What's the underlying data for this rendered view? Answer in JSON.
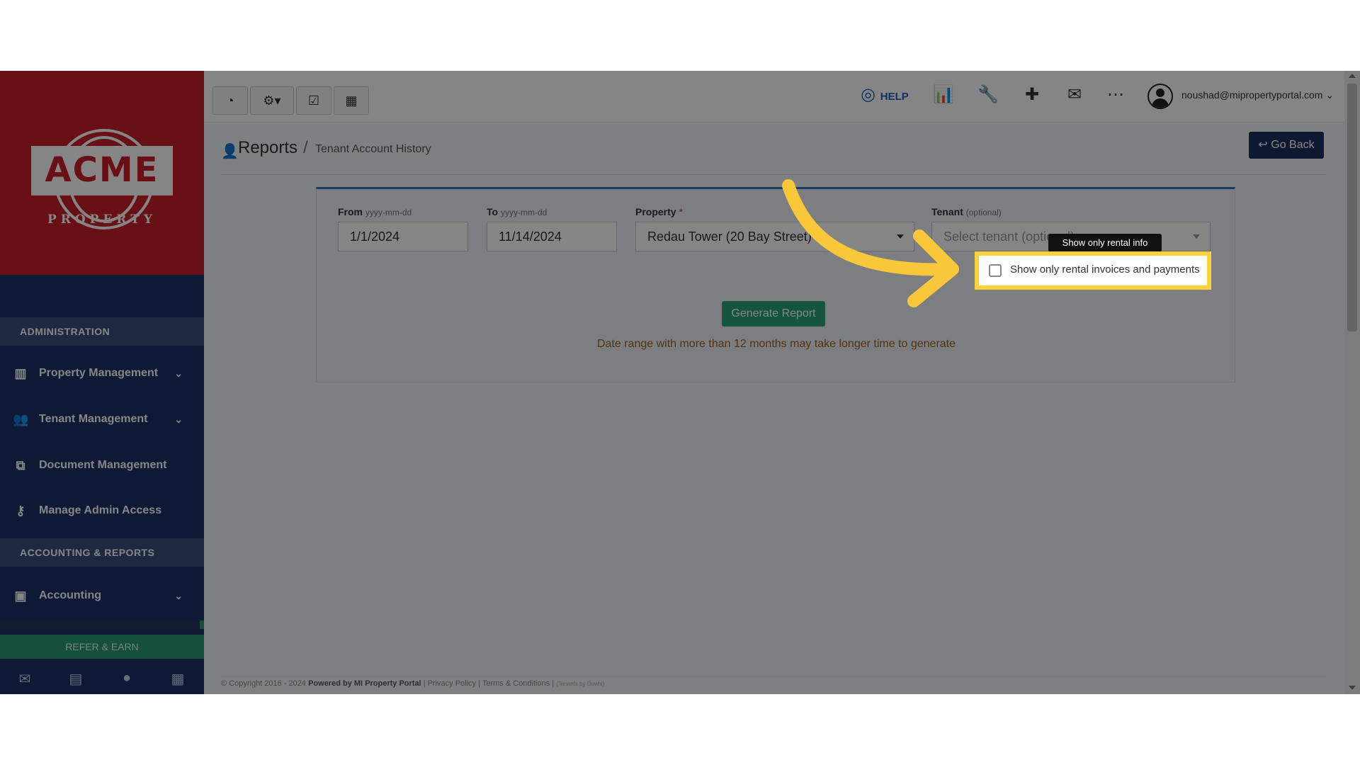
{
  "sidebar": {
    "logo": {
      "main": "ACME",
      "sub": "PROPERTY"
    },
    "sections": [
      {
        "label": "ADMINISTRATION"
      },
      {
        "label": "ACCOUNTING & REPORTS"
      }
    ],
    "items": [
      {
        "label": "Property Management",
        "icon": "building-icon",
        "has_children": true
      },
      {
        "label": "Tenant Management",
        "icon": "users-icon",
        "has_children": true
      },
      {
        "label": "Document Management",
        "icon": "documents-icon",
        "has_children": false
      },
      {
        "label": "Manage Admin Access",
        "icon": "key-icon",
        "has_children": false
      },
      {
        "label": "Accounting",
        "icon": "money-icon",
        "has_children": true
      }
    ],
    "refer_label": "REFER & EARN",
    "footer_icons": [
      "mail-icon",
      "briefcase-icon",
      "user-icon",
      "calculator-icon"
    ]
  },
  "topbar": {
    "left_buttons": [
      "dashboard-icon",
      "settings-icon",
      "calendar-icon",
      "calculator-icon"
    ],
    "help_label": "HELP",
    "right_icons": [
      "chart-icon",
      "wrench-icon",
      "plus-icon",
      "mail-icon",
      "more-icon"
    ],
    "user_email": "noushad@mipropertyportal.com"
  },
  "page": {
    "title": "Reports",
    "separator": "/",
    "subtitle": "Tenant Account History",
    "go_back_label": "Go Back"
  },
  "form": {
    "from": {
      "label": "From",
      "hint": "yyyy-mm-dd",
      "value": "1/1/2024"
    },
    "to": {
      "label": "To",
      "hint": "yyyy-mm-dd",
      "value": "11/14/2024"
    },
    "property": {
      "label": "Property",
      "required_mark": "*",
      "value": "Redau Tower (20 Bay Street)"
    },
    "tenant": {
      "label": "Tenant",
      "hint": "(optional)",
      "placeholder": "Select tenant (optional)"
    },
    "rental_only": {
      "label": "Show only rental invoices and payments",
      "checked": false,
      "tooltip": "Show only rental info"
    },
    "generate_label": "Generate Report",
    "note": "Date range with more than 12 months may take longer time to generate"
  },
  "footer": {
    "copyright": "© Copyright 2016 - 2024",
    "powered": "Powered by MI Property Portal",
    "links": "| Privacy Policy | Terms & Conditions |",
    "small": "(Tenants by Dowls)"
  },
  "colors": {
    "sidebar": "#1e3067",
    "logo_bg": "#c8202a",
    "accent_blue": "#3572c6",
    "generate_green": "#2aa279",
    "highlight": "#ffd23a"
  }
}
